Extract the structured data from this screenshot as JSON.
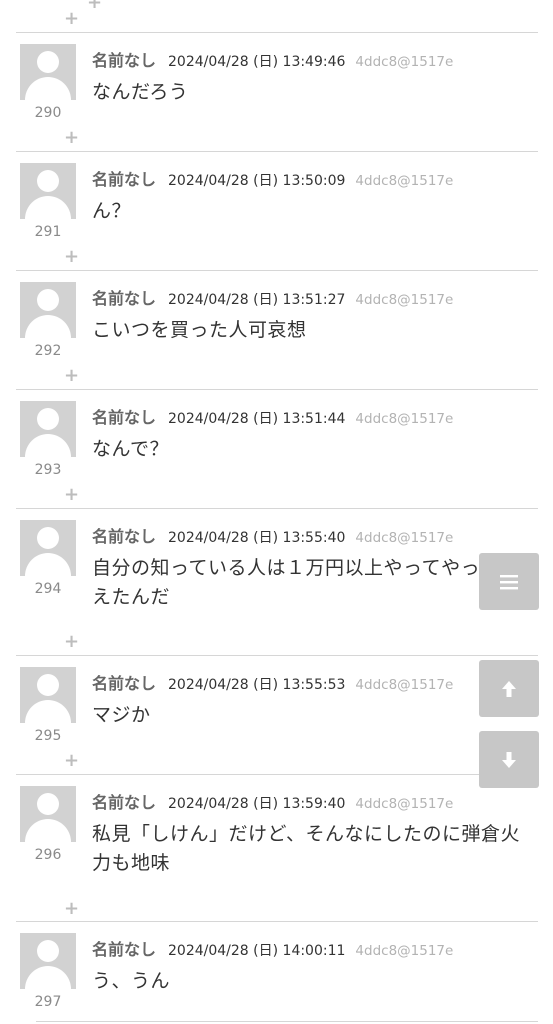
{
  "posts": [
    {
      "num": "290",
      "name": "名前なし",
      "date": "2024/04/28 (日) 13:49:46",
      "uid": "4ddc8@1517e",
      "body": "なんだろう"
    },
    {
      "num": "291",
      "name": "名前なし",
      "date": "2024/04/28 (日) 13:50:09",
      "uid": "4ddc8@1517e",
      "body": "ん？"
    },
    {
      "num": "292",
      "name": "名前なし",
      "date": "2024/04/28 (日) 13:51:27",
      "uid": "4ddc8@1517e",
      "body": "こいつを買った人可哀想"
    },
    {
      "num": "293",
      "name": "名前なし",
      "date": "2024/04/28 (日) 13:51:44",
      "uid": "4ddc8@1517e",
      "body": "なんで？"
    },
    {
      "num": "294",
      "name": "名前なし",
      "date": "2024/04/28 (日) 13:55:40",
      "uid": "4ddc8@1517e",
      "body": "自分の知っている人は１万円以上やってやっと買えたんだ"
    },
    {
      "num": "295",
      "name": "名前なし",
      "date": "2024/04/28 (日) 13:55:53",
      "uid": "4ddc8@1517e",
      "body": "マジか"
    },
    {
      "num": "296",
      "name": "名前なし",
      "date": "2024/04/28 (日) 13:59:40",
      "uid": "4ddc8@1517e",
      "body": "私見「しけん」だけど、そんなにしたのに弾倉火力も地味"
    },
    {
      "num": "297",
      "name": "名前なし",
      "date": "2024/04/28 (日) 14:00:11",
      "uid": "4ddc8@1517e",
      "body": "う、うん"
    }
  ],
  "controls": {
    "menu_icon": "menu-icon",
    "up_icon": "arrow-up-icon",
    "down_icon": "arrow-down-icon",
    "reply_icon": "plus-icon"
  },
  "colors": {
    "divider": "#d6d6d6",
    "avatar_bg": "#d2d2d2",
    "fab_bg": "#c7c7c7",
    "uid_text": "#b3b3b3"
  }
}
